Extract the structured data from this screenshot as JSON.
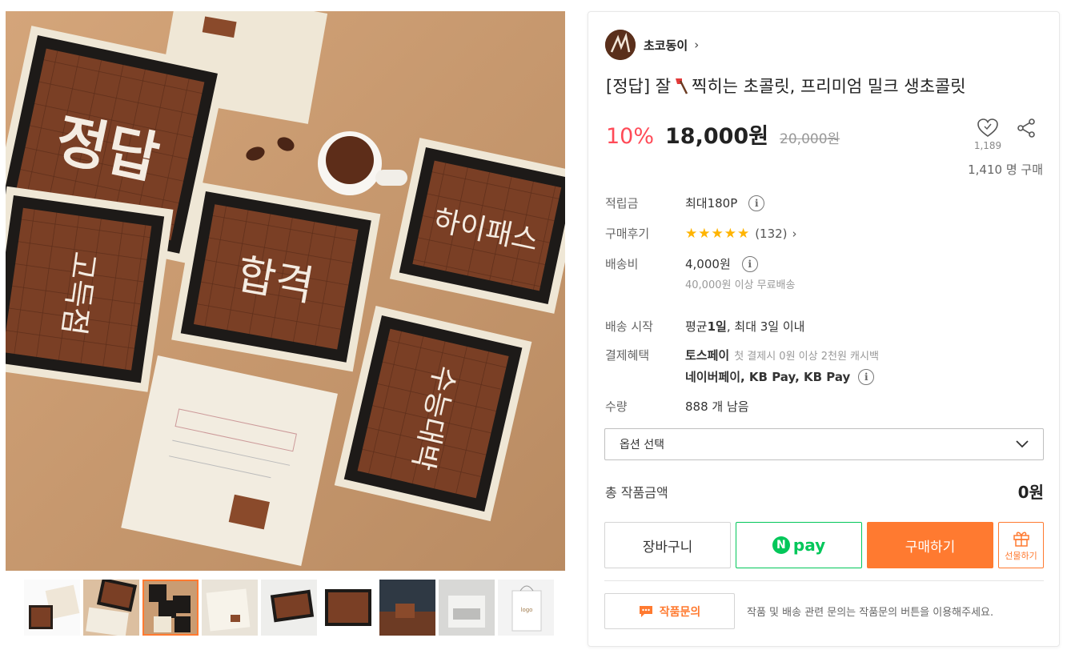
{
  "seller": {
    "name": "초코동이",
    "chevron": "›"
  },
  "product": {
    "title_prefix": "[정답] 잘",
    "title_suffix": "찍히는 초콜릿, 프리미엄 밀크 생초콜릿",
    "title_icon": "axe-icon",
    "discount": "10%",
    "price": "18,000원",
    "original_price": "20,000원",
    "like_count": "1,189",
    "buyers": "1,410 명 구매"
  },
  "photo_texts": {
    "box1": "정답",
    "box2": "합격",
    "box3": "하이패스",
    "box4": "고득점",
    "box5": "수능대박"
  },
  "info": {
    "points_label": "적립금",
    "points_value": "최대180P",
    "review_label": "구매후기",
    "review_stars": "★★★★★",
    "review_count": "(132)",
    "shipping_label": "배송비",
    "shipping_value": "4,000원",
    "shipping_note": "40,000원 이상 무료배송",
    "start_label": "배송 시작",
    "start_value_a": "평균 ",
    "start_value_b": "1일",
    "start_value_c": ", 최대 3일 이내",
    "pay_label": "결제혜택",
    "pay_toss": "토스페이",
    "pay_toss_note": "첫 결제시 0원 이상 2천원 캐시백",
    "pay_others": "네이버페이, KB Pay, KB Pay",
    "qty_label": "수량",
    "qty_value": "888 개 남음"
  },
  "option": {
    "placeholder": "옵션 선택"
  },
  "total": {
    "label": "총 작품금액",
    "value": "0원"
  },
  "buttons": {
    "cart": "장바구니",
    "npay_n": "N",
    "npay_text": "pay",
    "buy": "구매하기",
    "gift": "선물하기"
  },
  "inquiry": {
    "button": "작품문의",
    "note": "작품 및 배송 관련 문의는 작품문의 버튼을 이용해주세요."
  },
  "colors": {
    "accent": "#ff7a30",
    "discount": "#ff4a57",
    "npay": "#03c75a",
    "star": "#ffb400"
  }
}
